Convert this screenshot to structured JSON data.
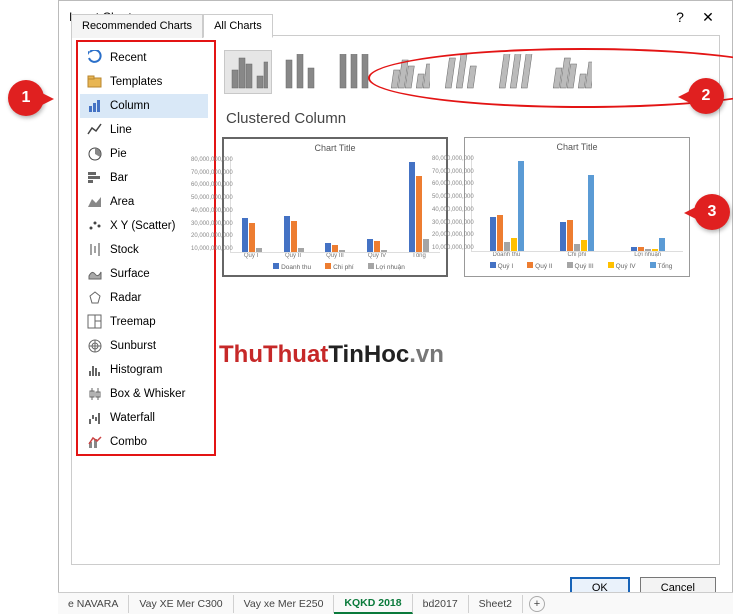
{
  "dialog": {
    "title": "Insert Chart",
    "tabs": {
      "recommended": "Recommended Charts",
      "all": "All Charts"
    },
    "active_tab": "all",
    "categories": [
      {
        "id": "recent",
        "label": "Recent"
      },
      {
        "id": "templates",
        "label": "Templates"
      },
      {
        "id": "column",
        "label": "Column"
      },
      {
        "id": "line",
        "label": "Line"
      },
      {
        "id": "pie",
        "label": "Pie"
      },
      {
        "id": "bar",
        "label": "Bar"
      },
      {
        "id": "area",
        "label": "Area"
      },
      {
        "id": "xy",
        "label": "X Y (Scatter)"
      },
      {
        "id": "stock",
        "label": "Stock"
      },
      {
        "id": "surface",
        "label": "Surface"
      },
      {
        "id": "radar",
        "label": "Radar"
      },
      {
        "id": "treemap",
        "label": "Treemap"
      },
      {
        "id": "sunburst",
        "label": "Sunburst"
      },
      {
        "id": "histogram",
        "label": "Histogram"
      },
      {
        "id": "boxwhisker",
        "label": "Box & Whisker"
      },
      {
        "id": "waterfall",
        "label": "Waterfall"
      },
      {
        "id": "combo",
        "label": "Combo"
      }
    ],
    "selected_category": "column",
    "subtype_title": "Clustered Column",
    "buttons": {
      "ok": "OK",
      "cancel": "Cancel"
    }
  },
  "callouts": {
    "c1": "1",
    "c2": "2",
    "c3": "3"
  },
  "watermark": {
    "a": "ThuThuat",
    "b": "TinHoc",
    "c": ".vn"
  },
  "sheets": [
    "e NAVARA",
    "Vay XE Mer C300",
    "Vay xe Mer E250",
    "KQKD 2018",
    "bd2017",
    "Sheet2"
  ],
  "active_sheet": "KQKD 2018",
  "chart_data": [
    {
      "type": "bar",
      "title": "Chart Title",
      "categories": [
        "Quý I",
        "Quý II",
        "Quý III",
        "Quý IV",
        "Tổng"
      ],
      "series": [
        {
          "name": "Doanh thu",
          "color": "#4472c4",
          "values": [
            30000000000,
            32000000000,
            8000000000,
            12000000000,
            80000000000
          ]
        },
        {
          "name": "Chi phí",
          "color": "#ed7d31",
          "values": [
            26000000000,
            28000000000,
            6000000000,
            10000000000,
            68000000000
          ]
        },
        {
          "name": "Lợi nhuận",
          "color": "#a5a5a5",
          "values": [
            4000000000,
            4000000000,
            2000000000,
            2000000000,
            12000000000
          ]
        }
      ],
      "yticks": [
        "80,000,000,000",
        "70,000,000,000",
        "60,000,000,000",
        "50,000,000,000",
        "40,000,000,000",
        "30,000,000,000",
        "20,000,000,000",
        "10,000,000,000"
      ],
      "ymax": 80000000000
    },
    {
      "type": "bar",
      "title": "Chart Title",
      "categories": [
        "Doanh thu",
        "Chi phí",
        "Lợi nhuận"
      ],
      "series": [
        {
          "name": "Quý I",
          "color": "#4472c4",
          "values": [
            30000000000,
            26000000000,
            4000000000
          ]
        },
        {
          "name": "Quý II",
          "color": "#ed7d31",
          "values": [
            32000000000,
            28000000000,
            4000000000
          ]
        },
        {
          "name": "Quý III",
          "color": "#a5a5a5",
          "values": [
            8000000000,
            6000000000,
            2000000000
          ]
        },
        {
          "name": "Quý IV",
          "color": "#ffc000",
          "values": [
            12000000000,
            10000000000,
            2000000000
          ]
        },
        {
          "name": "Tổng",
          "color": "#5b9bd5",
          "values": [
            80000000000,
            68000000000,
            12000000000
          ]
        }
      ],
      "yticks": [
        "80,000,000,000",
        "70,000,000,000",
        "60,000,000,000",
        "50,000,000,000",
        "40,000,000,000",
        "30,000,000,000",
        "20,000,000,000",
        "10,000,000,000"
      ],
      "ymax": 80000000000
    }
  ]
}
